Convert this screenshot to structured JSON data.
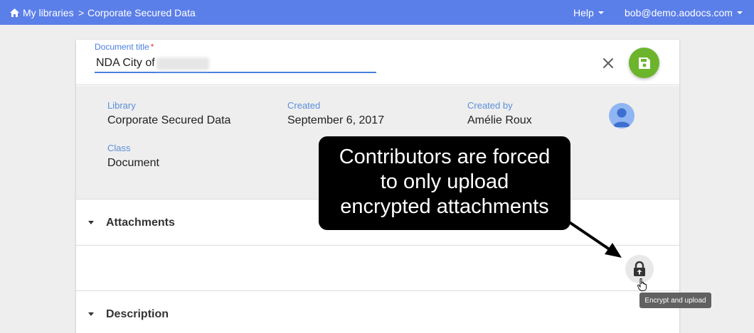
{
  "topbar": {
    "home_label": "My libraries",
    "separator": ">",
    "current": "Corporate Secured Data",
    "help_label": "Help",
    "user_label": "bob@demo.aodocs.com",
    "home_icon": "home-icon",
    "color": "#5b7fe8"
  },
  "document": {
    "title_label": "Document title",
    "required_mark": "*",
    "title_value": "NDA City of",
    "close_icon": "close-icon",
    "save_icon": "save-icon",
    "save_color": "#6cb42c"
  },
  "meta": {
    "library_label": "Library",
    "library_value": "Corporate Secured Data",
    "created_label": "Created",
    "created_value": "September 6, 2017",
    "created_by_label": "Created by",
    "created_by_value": "Amélie Roux",
    "class_label": "Class",
    "class_value": "Document",
    "avatar_icon": "user-avatar-icon"
  },
  "sections": {
    "attachments_title": "Attachments",
    "description_title": "Description"
  },
  "attachments": {
    "encrypt_icon": "lock-icon",
    "tooltip": "Encrypt and upload"
  },
  "callout": {
    "lines": [
      "Contributors are forced",
      "to only upload",
      "encrypted attachments"
    ]
  }
}
